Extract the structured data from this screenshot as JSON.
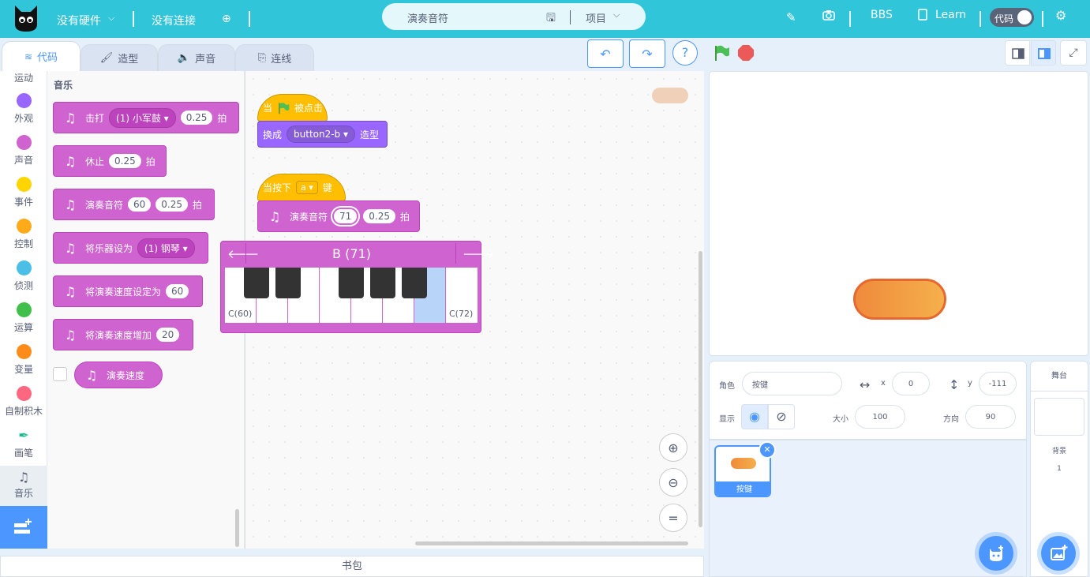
{
  "topbar": {
    "hardware": "没有硬件",
    "connection": "没有连接",
    "project_name": "演奏音符",
    "project_menu": "项目",
    "bbs": "BBS",
    "learn": "Learn",
    "mode_toggle": "代码"
  },
  "tabs": [
    {
      "label": "代码"
    },
    {
      "label": "造型"
    },
    {
      "label": "声音"
    },
    {
      "label": "连线"
    }
  ],
  "categories": [
    {
      "label": "运动",
      "color": "#4c97ff"
    },
    {
      "label": "外观",
      "color": "#9966ff"
    },
    {
      "label": "声音",
      "color": "#cf63cf"
    },
    {
      "label": "事件",
      "color": "#ffd500"
    },
    {
      "label": "控制",
      "color": "#ffab19"
    },
    {
      "label": "侦测",
      "color": "#4cbfe6"
    },
    {
      "label": "运算",
      "color": "#40bf4a"
    },
    {
      "label": "变量",
      "color": "#ff8c1a"
    },
    {
      "label": "自制积木",
      "color": "#ff6680"
    },
    {
      "label": "画笔"
    },
    {
      "label": "音乐"
    }
  ],
  "palette": {
    "title": "音乐",
    "blocks": {
      "drum": {
        "label": "击打",
        "dropdown": "(1) 小军鼓",
        "value": "0.25",
        "unit": "拍"
      },
      "rest": {
        "label": "休止",
        "value": "0.25",
        "unit": "拍"
      },
      "play_note": {
        "label": "演奏音符",
        "note": "60",
        "value": "0.25",
        "unit": "拍"
      },
      "set_instrument": {
        "label": "将乐器设为",
        "dropdown": "(1) 钢琴"
      },
      "set_tempo": {
        "label": "将演奏速度设定为",
        "value": "60"
      },
      "change_tempo": {
        "label": "将演奏速度增加",
        "value": "20"
      },
      "tempo": {
        "label": "演奏速度"
      }
    }
  },
  "script": {
    "when_flag": {
      "prefix": "当",
      "suffix": "被点击"
    },
    "switch_costume": {
      "label": "换成",
      "dropdown": "button2-b",
      "suffix": "造型"
    },
    "when_key": {
      "prefix": "当按下",
      "key": "a",
      "suffix": "键"
    },
    "play_note": {
      "label": "演奏音符",
      "note": "71",
      "value": "0.25",
      "unit": "拍"
    }
  },
  "piano": {
    "title": "B (71)",
    "low_label": "C(60)",
    "high_label": "C(72)"
  },
  "sprite_info": {
    "sprite_label": "角色",
    "sprite_name": "按键",
    "x_label": "x",
    "x_value": "0",
    "y_label": "y",
    "y_value": "-111",
    "show_label": "显示",
    "size_label": "大小",
    "size_value": "100",
    "direction_label": "方向",
    "direction_value": "90"
  },
  "sprite_list": [
    {
      "name": "按键"
    }
  ],
  "stage_panel": {
    "title": "舞台",
    "backdrop_label": "背景",
    "backdrop_count": "1"
  },
  "backpack": {
    "label": "书包"
  },
  "colors": {
    "topbar": "#30c5d9",
    "music": "#cf63cf",
    "event": "#ffbf00",
    "looks": "#9966ff",
    "accent": "#4c97ff"
  }
}
